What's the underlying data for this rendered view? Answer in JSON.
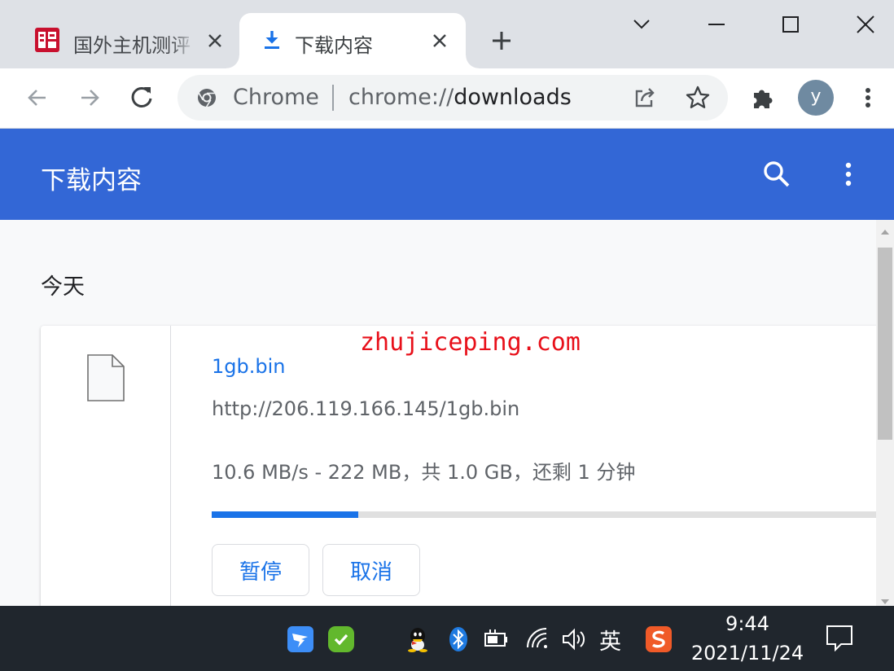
{
  "browser": {
    "tabs": [
      {
        "title": "国外主机测评",
        "active": false
      },
      {
        "title": "下载内容",
        "active": true
      }
    ],
    "omnibox": {
      "chip_label": "Chrome",
      "url_scheme": "chrome://",
      "url_path": "downloads"
    },
    "profile_initial": "y"
  },
  "downloads_page": {
    "title": "下载内容",
    "section_date": "今天",
    "item": {
      "file_name": "1gb.bin",
      "url": "http://206.119.166.145/1gb.bin",
      "status": "10.6 MB/s - 222 MB，共 1.0 GB，还剩 1 分钟",
      "progress_percent": 22,
      "pause_label": "暂停",
      "cancel_label": "取消"
    }
  },
  "watermark": "zhujiceping.com",
  "taskbar": {
    "ime_label": "英",
    "time": "9:44",
    "date": "2021/11/24"
  },
  "colors": {
    "header_blue": "#3367d6",
    "link_blue": "#1a73e8",
    "taskbar": "#20262d",
    "watermark_red": "#e8101a"
  },
  "icons": [
    "site-favicon",
    "download-icon",
    "close-icon",
    "new-tab-icon",
    "chevron-down-icon",
    "minimize-icon",
    "maximize-icon",
    "window-close-icon",
    "back-icon",
    "forward-icon",
    "reload-icon",
    "chrome-logo-icon",
    "share-icon",
    "star-icon",
    "extensions-icon",
    "more-vert-icon",
    "search-icon",
    "file-icon",
    "dingtalk-icon",
    "wechat-icon",
    "qq-icon",
    "bluetooth-icon",
    "battery-icon",
    "wifi-icon",
    "volume-icon",
    "sogou-icon"
  ]
}
